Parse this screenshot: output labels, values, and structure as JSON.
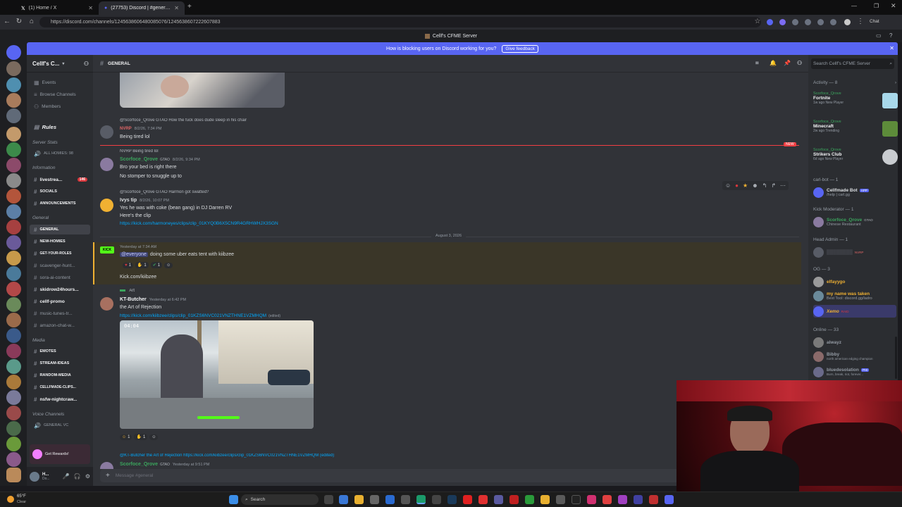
{
  "browser": {
    "tabs": [
      {
        "title": "(1) Home / X"
      },
      {
        "title": "(27753) Discord | #general | Cellf's CF..."
      }
    ],
    "url": "https://discord.com/channels/1245638606480085076/1245638607222607883",
    "new_tab": "+",
    "chat_label": "Chat"
  },
  "discord": {
    "window_title": "Cellf's CFME Server",
    "notice": {
      "text": "How is blocking users on Discord working for you?",
      "button": "Give feedback"
    },
    "server_name": "Cellf's C...",
    "sidebar_top": [
      "Events",
      "Browse Channels",
      "Members"
    ],
    "rules": "Rules",
    "server_stats_cat": "Server Stats",
    "all_homies": "ALL HOMIES: 98",
    "information_cat": "Information",
    "livestream": {
      "name": "livestrea...",
      "badge": "146"
    },
    "socials": "SOCIALS",
    "announcements": "ANNOUNCEMENTS",
    "general_cat": "General",
    "channels": [
      "GENERAL",
      "NEW-HOMIES",
      "GET-YOUR-ROLES",
      "scavenger-hunt...",
      "sora-ai-content",
      "skidrow24hours...",
      "cellf-promo",
      "music-tunes-tr...",
      "amazon-chat-w..."
    ],
    "media_cat": "Media",
    "media_channels": [
      "EMOTES",
      "STREAM-IDEAS",
      "RANDOM-MEDIA",
      "CELLFMADE-CLIPS...",
      "nsfw-nightcraw..."
    ],
    "voice_cat": "Voice Channels",
    "voice_channels": [
      "GENERAL VC"
    ],
    "get_rewards": "Get Rewards!",
    "user": {
      "name": "H...",
      "status": "Do..."
    },
    "channel_header": "GENERAL",
    "composer_placeholder": "Message #general",
    "date_divider": "August 3, 2026",
    "new_label": "NEW",
    "messages": [
      {
        "reply": "@Scorfoce_Qrove  GTAO  How the fuck does dude sleep in his chair",
        "author": "NVRP",
        "time": "8/2/26, 7:34 PM",
        "text": "Being tired lol",
        "author_color": "#e06666"
      },
      {
        "reply": "NVRP  Being tired lol",
        "author": "Scorfoce_Qrove",
        "tag": "GTAO",
        "time": "8/2/26, 9:34 PM",
        "lines": [
          "Bro your bed is right there",
          "No stomper to snuggle up to"
        ],
        "author_color": "#3ba55d"
      },
      {
        "reply": "@Scorfoce_Qrove  GTAO  Harmon got swatted?",
        "author": "Ivys tip",
        "time": "8/2/26, 10:07 PM",
        "lines": [
          "Yes he was with coke (bean gang) in DJ Darren RV",
          "Here's the clip"
        ],
        "link": "https://kick.com/harmoneyes/clips/clip_01KYQ0B6X5CN9R4GRHWHJX3SGN",
        "author_color": "#dbdee1"
      },
      {
        "author": "KICK",
        "time": "Yesterday at 7:34 AM",
        "mention": "@everyone",
        "text": "doing some uber eats tent with kiibzee",
        "reactions": [
          "1",
          "1",
          "1"
        ],
        "after": "Kick.com/kiibzee",
        "author_color": "#53fc18"
      },
      {
        "reply": "Art",
        "author": "KT-Butcher",
        "time": "Yesterday at 6:42 PM",
        "text": "the Art of Rejection",
        "link": "https://kick.com/kiibzee/clips/clip_01KZS6NVC021VNZTHNE1VZMHQM",
        "edited": "(edited)",
        "video_time": "04:04",
        "reactions": [
          "1",
          "1"
        ],
        "author_color": "#f2f3f5"
      },
      {
        "reply": "@KT-Butcher  the Art of Rejection  https://kick.com/kiibzee/clips/clip_01KZS6NVC021VNZTHNE1VZMHQM (edited)",
        "author": "Scorfoce_Qrove",
        "tag": "GTAO",
        "time": "Yesterday at 9:51 PM",
        "author_color": "#3ba55d"
      }
    ],
    "members": {
      "search_placeholder": "Search Cellf's CFME Server",
      "activity_header": "Activity — 8",
      "activities": [
        {
          "user": "Scorfoce_Qrove",
          "game": "Fortnite",
          "sub": "1w ago  New Player"
        },
        {
          "user": "Scorfoce_Qrove",
          "game": "Minecraft",
          "sub": "2w ago  Trending"
        },
        {
          "user": "Scorfoce_Qrove",
          "game": "Strikers Club",
          "sub": "6d ago  New Player"
        }
      ],
      "groups": [
        {
          "header": "carl-bot — 1",
          "items": [
            {
              "name": "Cellfmade Bot",
              "tag": "APP",
              "sub": "/help | carl.gg",
              "color": "#dbdee1"
            }
          ]
        },
        {
          "header": "Kick Moderator — 1",
          "items": [
            {
              "name": "Scorfoce_Qrove",
              "tag": "GTAO",
              "sub": "Chinese Restaurant",
              "color": "#3ba55d"
            }
          ]
        },
        {
          "header": "Head Admin — 1",
          "items": [
            {
              "name": "NVRP",
              "tag": "NVRP",
              "sub": "",
              "color": "#e06666"
            }
          ]
        },
        {
          "header": "OG — 3",
          "items": [
            {
              "name": "elfayygo",
              "sub": "",
              "color": "#f0b132"
            },
            {
              "name": "my name was taken",
              "sub": "Best Tool: discord.gg/ladro",
              "color": "#f0b132"
            },
            {
              "name": "Xemo",
              "tag": "RAID",
              "sub": "",
              "color": "#f0b132"
            }
          ]
        },
        {
          "header": "Online — 33",
          "items": [
            {
              "name": "alwayz",
              "sub": "",
              "color": "#949ba4"
            },
            {
              "name": "Bibby",
              "sub": "north american edging champion",
              "color": "#949ba4"
            },
            {
              "name": "bluedesolation",
              "tag": "PHI",
              "sub": "Burn, break, riot, forever...",
              "color": "#949ba4"
            }
          ]
        }
      ]
    }
  },
  "taskbar": {
    "weather_temp": "65°F",
    "weather_text": "Clear",
    "search": "Search"
  },
  "colors": {
    "blurple": "#5865f2",
    "link": "#00a8fc",
    "mention_bg": "#3c4270",
    "red": "#da373c"
  }
}
